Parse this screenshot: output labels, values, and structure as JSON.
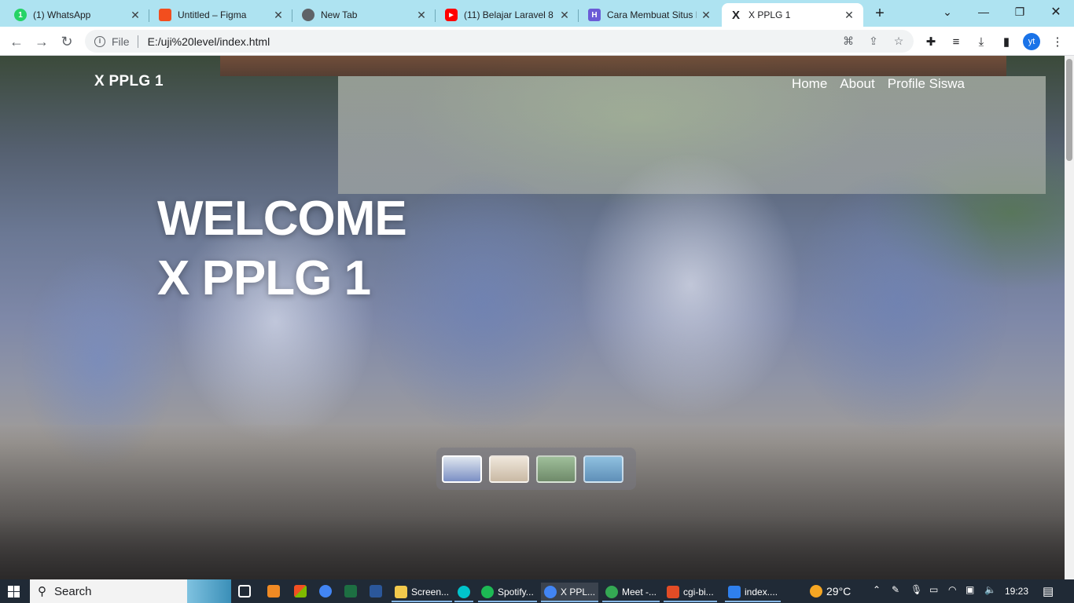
{
  "browser": {
    "tabs": [
      {
        "title": "(1) WhatsApp",
        "icon": "whatsapp-icon",
        "color": "#25d366",
        "badge": "1"
      },
      {
        "title": "Untitled – Figma",
        "icon": "figma-icon",
        "color": "#f24e1e",
        "badge": ""
      },
      {
        "title": "New Tab",
        "icon": "chrome-icon",
        "color": "#5f6368",
        "badge": ""
      },
      {
        "title": "(11) Belajar Laravel 8 |",
        "icon": "youtube-icon",
        "color": "#ff0000",
        "badge": "▶"
      },
      {
        "title": "Cara Membuat Situs E",
        "icon": "site-icon",
        "color": "#6b5bd6",
        "badge": "H"
      },
      {
        "title": "X PPLG 1",
        "icon": "x-logo-icon",
        "color": "#202124",
        "badge": "X"
      }
    ],
    "active_tab": 5,
    "address": {
      "scheme": "File",
      "url": "E:/uji%20level/index.html"
    },
    "profile_initials": "yt"
  },
  "page": {
    "brand": "X PPLG 1",
    "nav": [
      "Home",
      "About",
      "Profile Siswa"
    ],
    "hero_line1": "WELCOME",
    "hero_line2": "X PPLG 1",
    "thumbnails": [
      {
        "name": "thumb-1",
        "selected": true,
        "color": "#7b8fc4"
      },
      {
        "name": "thumb-2",
        "selected": false,
        "color": "#c9b9a4"
      },
      {
        "name": "thumb-3",
        "selected": false,
        "color": "#6f8a6a"
      },
      {
        "name": "thumb-4",
        "selected": false,
        "color": "#5f8fb8"
      }
    ]
  },
  "taskbar": {
    "search_label": "Search",
    "items": [
      {
        "label": "Screen...",
        "icon": "folder-icon",
        "color": "#f2c94c"
      },
      {
        "label": "",
        "icon": "canva-icon",
        "color": "#00c4cc"
      },
      {
        "label": "Spotify...",
        "icon": "spotify-icon",
        "color": "#1db954"
      },
      {
        "label": "X PPL...",
        "icon": "chrome-icon",
        "color": "#4285f4"
      },
      {
        "label": "Meet -...",
        "icon": "chrome-icon",
        "color": "#34a853"
      },
      {
        "label": "cgi-bi...",
        "icon": "app-icon",
        "color": "#e34c26"
      },
      {
        "label": "index....",
        "icon": "vscode-icon",
        "color": "#2f80ed"
      }
    ],
    "weather": "29°C",
    "time": "19:23"
  }
}
